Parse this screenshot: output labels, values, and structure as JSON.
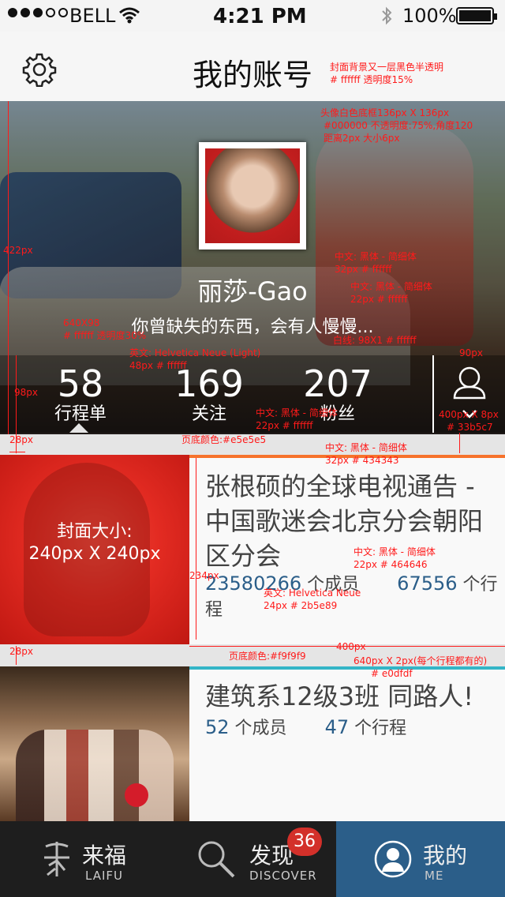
{
  "status": {
    "carrier": "BELL",
    "time": "4:21 PM",
    "battery": "100%"
  },
  "header": {
    "title": "我的账号"
  },
  "profile": {
    "name": "丽莎-Gao",
    "motto": "你曾缺失的东西，会有人慢慢..."
  },
  "stats": [
    {
      "num": "58",
      "label": "行程单"
    },
    {
      "num": "169",
      "label": "关注"
    },
    {
      "num": "207",
      "label": "粉丝"
    }
  ],
  "groups": [
    {
      "title": "张根硕的全球电视通告 - 中国歌迷会北京分会朝阳区分会",
      "members": "23580266",
      "members_label": "个成员",
      "trips": "67556",
      "trips_label": "个行程",
      "accent": "#f6722b",
      "cover_caption_1": "封面大小:",
      "cover_caption_2": "240px X 240px"
    },
    {
      "title": "建筑系12级3班 同路人!",
      "members": "52",
      "members_label": "个成员",
      "trips": "47",
      "trips_label": "个行程",
      "accent": "#33b5c7"
    }
  ],
  "tabs": [
    {
      "label": "来福",
      "sub": "LAIFU"
    },
    {
      "label": "发现",
      "sub": "DISCOVER",
      "badge": "36"
    },
    {
      "label": "我的",
      "sub": "ME"
    }
  ],
  "annotations": {
    "a1": "封面背景又一层黑色半透明",
    "a2": "# ffffff  透明度15%",
    "a3": "头像白色底框136px X 136px",
    "a4": "#000000 不透明度:75%,角度120",
    "a5": "距离2px  大小6px",
    "a6": "中文:  黑体 - 简细体",
    "a7": "32px    # ffffff",
    "a8": "中文:  黑体 - 简细体",
    "a9": "22px    # ffffff",
    "a10": "640X98",
    "a11": "# ffffff  透明度30%",
    "a12": "英文: Helvetica Neue (Light)",
    "a13": "48px    # ffffff",
    "a14": "白线: 98X1    # ffffff",
    "a15": "90px",
    "a16": "98px",
    "a17": "422px",
    "a18": "中文: 黑体 - 简细体",
    "a19": "22px    # ffffff",
    "a20": "400px X 8px",
    "a21": "# 33b5c7",
    "a22": "28px",
    "a23": "页底颜色:#e5e5e5",
    "a24": "中文: 黑体 - 简细体",
    "a25": "32px    # 434343",
    "a26": "中文: 黑体 - 简细体",
    "a27": "22px    # 464646",
    "a28": "234px",
    "a29": "英文: Helvetica Neue",
    "a30": "24px    # 2b5e89",
    "a31": "28px",
    "a32": "页底颜色:#f9f9f9",
    "a33": "400px",
    "a34": "640px X 2px(每个行程都有的)",
    "a35": "# e0dfdf"
  }
}
